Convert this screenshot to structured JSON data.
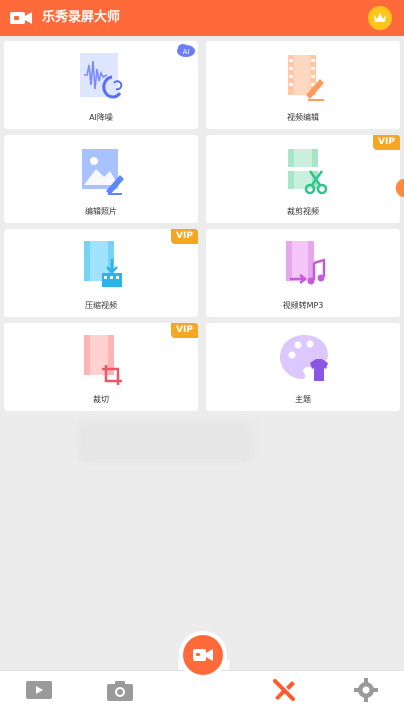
{
  "app": {
    "title": "乐秀录屏大师"
  },
  "colors": {
    "brand": "#ff6a3a",
    "vip": "#f5a623",
    "crown": "#ffc51a",
    "nav_active": "#ff5a2e"
  },
  "tools": [
    {
      "label": "AI降噪",
      "icon": "ai-noise-reduction-icon",
      "badge": "AI"
    },
    {
      "label": "视频编辑",
      "icon": "video-edit-icon",
      "badge": ""
    },
    {
      "label": "编辑照片",
      "icon": "photo-edit-icon",
      "badge": ""
    },
    {
      "label": "裁剪视频",
      "icon": "video-trim-icon",
      "badge": "VIP"
    },
    {
      "label": "压缩视频",
      "icon": "video-compress-icon",
      "badge": "VIP"
    },
    {
      "label": "视频转MP3",
      "icon": "video-to-mp3-icon",
      "badge": ""
    },
    {
      "label": "裁切",
      "icon": "crop-icon",
      "badge": "VIP"
    },
    {
      "label": "主题",
      "icon": "theme-palette-icon",
      "badge": ""
    }
  ],
  "badges": {
    "vip": "VIP",
    "ai": "AI"
  },
  "bottom_nav": [
    {
      "icon": "video-list-icon",
      "active": false
    },
    {
      "icon": "camera-icon",
      "active": false
    },
    {
      "icon": "tools-icon",
      "active": true
    },
    {
      "icon": "settings-icon",
      "active": false
    }
  ]
}
